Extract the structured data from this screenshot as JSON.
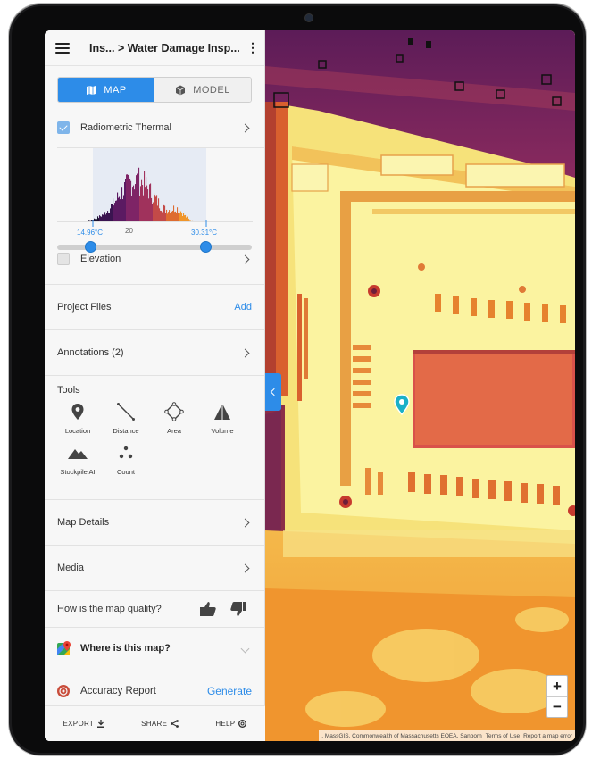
{
  "header": {
    "breadcrumb": "Ins...  > Water Damage Insp..."
  },
  "view_toggle": {
    "map_label": "MAP",
    "model_label": "MODEL",
    "active": "MAP"
  },
  "layers": {
    "thermal_label": "Radiometric Thermal",
    "thermal_checked": true,
    "elevation_label": "Elevation",
    "elevation_checked": false
  },
  "histogram": {
    "low_temp": "14.96°C",
    "mid_tick": "20",
    "high_temp": "30.31°C"
  },
  "sections": {
    "project_files": "Project Files",
    "project_files_action": "Add",
    "annotations": "Annotations (2)",
    "tools_title": "Tools",
    "map_details": "Map Details",
    "media": "Media",
    "quality_question": "How is the map quality?",
    "where_map": "Where is this map?",
    "accuracy_report": "Accuracy Report",
    "accuracy_action": "Generate"
  },
  "tools": [
    {
      "label": "Location",
      "icon": "location-pin-icon"
    },
    {
      "label": "Distance",
      "icon": "ruler-line-icon"
    },
    {
      "label": "Area",
      "icon": "polygon-area-icon"
    },
    {
      "label": "Volume",
      "icon": "volume-pyramid-icon"
    },
    {
      "label": "Stockpile AI",
      "icon": "mountain-icon"
    },
    {
      "label": "Count",
      "icon": "dots-count-icon"
    }
  ],
  "footer": {
    "export": "EXPORT",
    "share": "SHARE",
    "help": "HELP"
  },
  "map": {
    "zoom_in": "+",
    "zoom_out": "−",
    "attribution": ", MassGIS, Commonwealth of Massachusetts EOEA, Sanborn",
    "terms": "Terms of Use",
    "report_error": "Report a map error"
  },
  "colors": {
    "accent": "#2d8ce8",
    "thermal_hot": "#fbf5a6",
    "thermal_warm": "#f08a2a",
    "thermal_mid": "#d34a3a",
    "thermal_cool": "#6e1e6a"
  }
}
